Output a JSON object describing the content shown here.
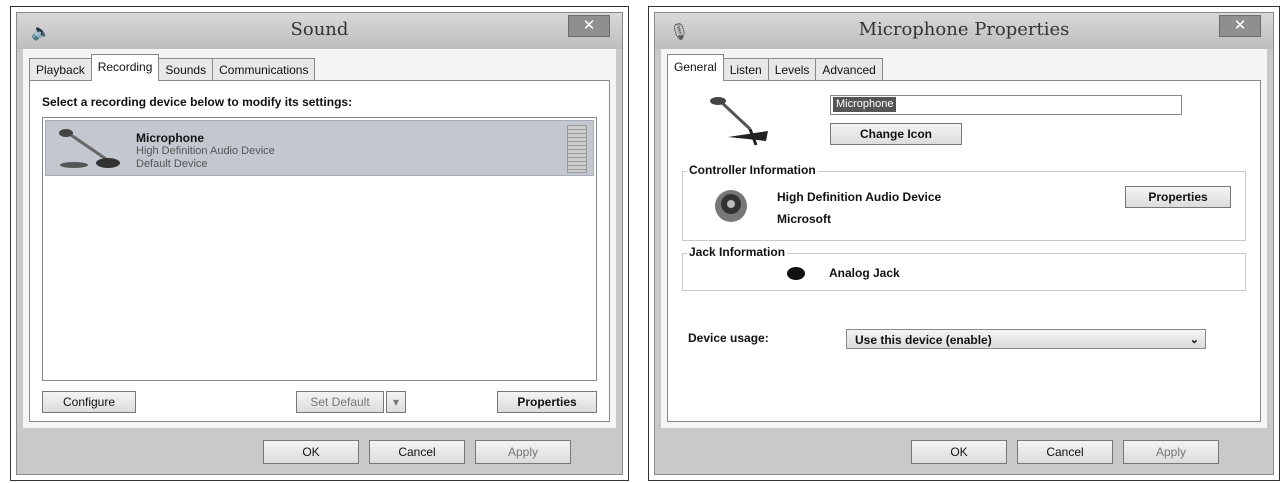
{
  "sound": {
    "title": "Sound",
    "close_glyph": "✕",
    "tabs": [
      "Playback",
      "Recording",
      "Sounds",
      "Communications"
    ],
    "active_tab": "Recording",
    "instruction": "Select a recording device below to modify its settings:",
    "device": {
      "name": "Microphone",
      "driver": "High Definition Audio Device",
      "status": "Default Device"
    },
    "configure_label": "Configure",
    "set_default_label": "Set Default",
    "set_default_arrow": "▾",
    "properties_label": "Properties",
    "ok_label": "OK",
    "cancel_label": "Cancel",
    "apply_label": "Apply"
  },
  "mic_props": {
    "title": "Microphone Properties",
    "close_glyph": "✕",
    "tabs": [
      "General",
      "Listen",
      "Levels",
      "Advanced"
    ],
    "active_tab": "General",
    "name_value": "Microphone",
    "change_icon_label": "Change Icon",
    "controller_group_label": "Controller Information",
    "controller_name": "High Definition Audio Device",
    "controller_vendor": "Microsoft",
    "controller_properties_label": "Properties",
    "jack_group_label": "Jack Information",
    "jack_name": "Analog Jack",
    "device_usage_label": "Device usage:",
    "device_usage_value": "Use this device (enable)",
    "device_usage_arrow": "⌄",
    "ok_label": "OK",
    "cancel_label": "Cancel",
    "apply_label": "Apply"
  }
}
